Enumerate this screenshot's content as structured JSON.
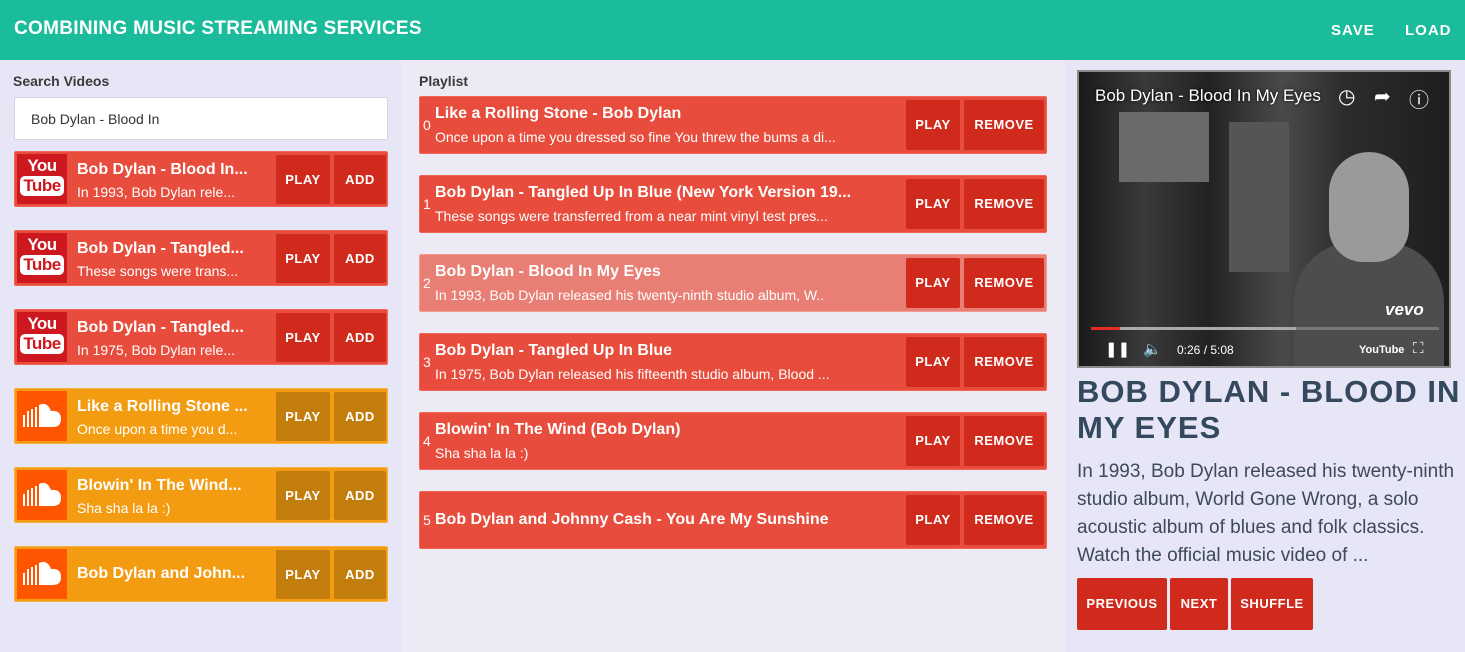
{
  "app": {
    "title": "COMBINING MUSIC STREAMING SERVICES",
    "save_label": "SAVE",
    "load_label": "LOAD"
  },
  "search": {
    "label": "Search Videos",
    "value": "Bob Dylan - Blood In",
    "play_label": "PLAY",
    "add_label": "ADD",
    "results": [
      {
        "source": "youtube",
        "title": "Bob Dylan - Blood In...",
        "desc": "In 1993, Bob Dylan rele..."
      },
      {
        "source": "youtube",
        "title": "Bob Dylan - Tangled...",
        "desc": "These songs were trans..."
      },
      {
        "source": "youtube",
        "title": "Bob Dylan - Tangled...",
        "desc": "In 1975, Bob Dylan rele..."
      },
      {
        "source": "soundcloud",
        "title": "Like a Rolling Stone ...",
        "desc": "Once upon a time you d..."
      },
      {
        "source": "soundcloud",
        "title": "Blowin' In The Wind...",
        "desc": "Sha sha la la :)"
      },
      {
        "source": "soundcloud",
        "title": "Bob Dylan and John...",
        "desc": ""
      }
    ]
  },
  "playlist": {
    "label": "Playlist",
    "play_label": "PLAY",
    "remove_label": "REMOVE",
    "items": [
      {
        "index": "0",
        "title": "Like a Rolling Stone - Bob Dylan",
        "desc": "Once upon a time you dressed so fine You threw the bums a di..."
      },
      {
        "index": "1",
        "title": "Bob Dylan - Tangled Up In Blue (New York Version 19...",
        "desc": "These songs were transferred from a near mint vinyl test pres..."
      },
      {
        "index": "2",
        "title": "Bob Dylan - Blood In My Eyes",
        "desc": "In 1993, Bob Dylan released his twenty-ninth studio album, W..",
        "active": true
      },
      {
        "index": "3",
        "title": "Bob Dylan - Tangled Up In Blue",
        "desc": "In 1975, Bob Dylan released his fifteenth studio album, Blood ..."
      },
      {
        "index": "4",
        "title": "Blowin' In The Wind (Bob Dylan)",
        "desc": "Sha sha la la :)"
      },
      {
        "index": "5",
        "title": "Bob Dylan and Johnny Cash - You Are My Sunshine",
        "desc": ""
      }
    ]
  },
  "player": {
    "video_title": "Bob Dylan - Blood In My Eyes",
    "vevo": "vevo",
    "youtube_badge": "YouTube",
    "time": "0:26 / 5:08",
    "progress": 0.084,
    "buffered": 0.59,
    "now_playing_title": "BOB DYLAN - BLOOD IN MY EYES",
    "now_playing_desc": "In 1993, Bob Dylan released his twenty-ninth studio album, World Gone Wrong, a solo acoustic album of blues and folk classics. Watch the official music video of ...",
    "previous_label": "PREVIOUS",
    "next_label": "NEXT",
    "shuffle_label": "SHUFFLE"
  }
}
